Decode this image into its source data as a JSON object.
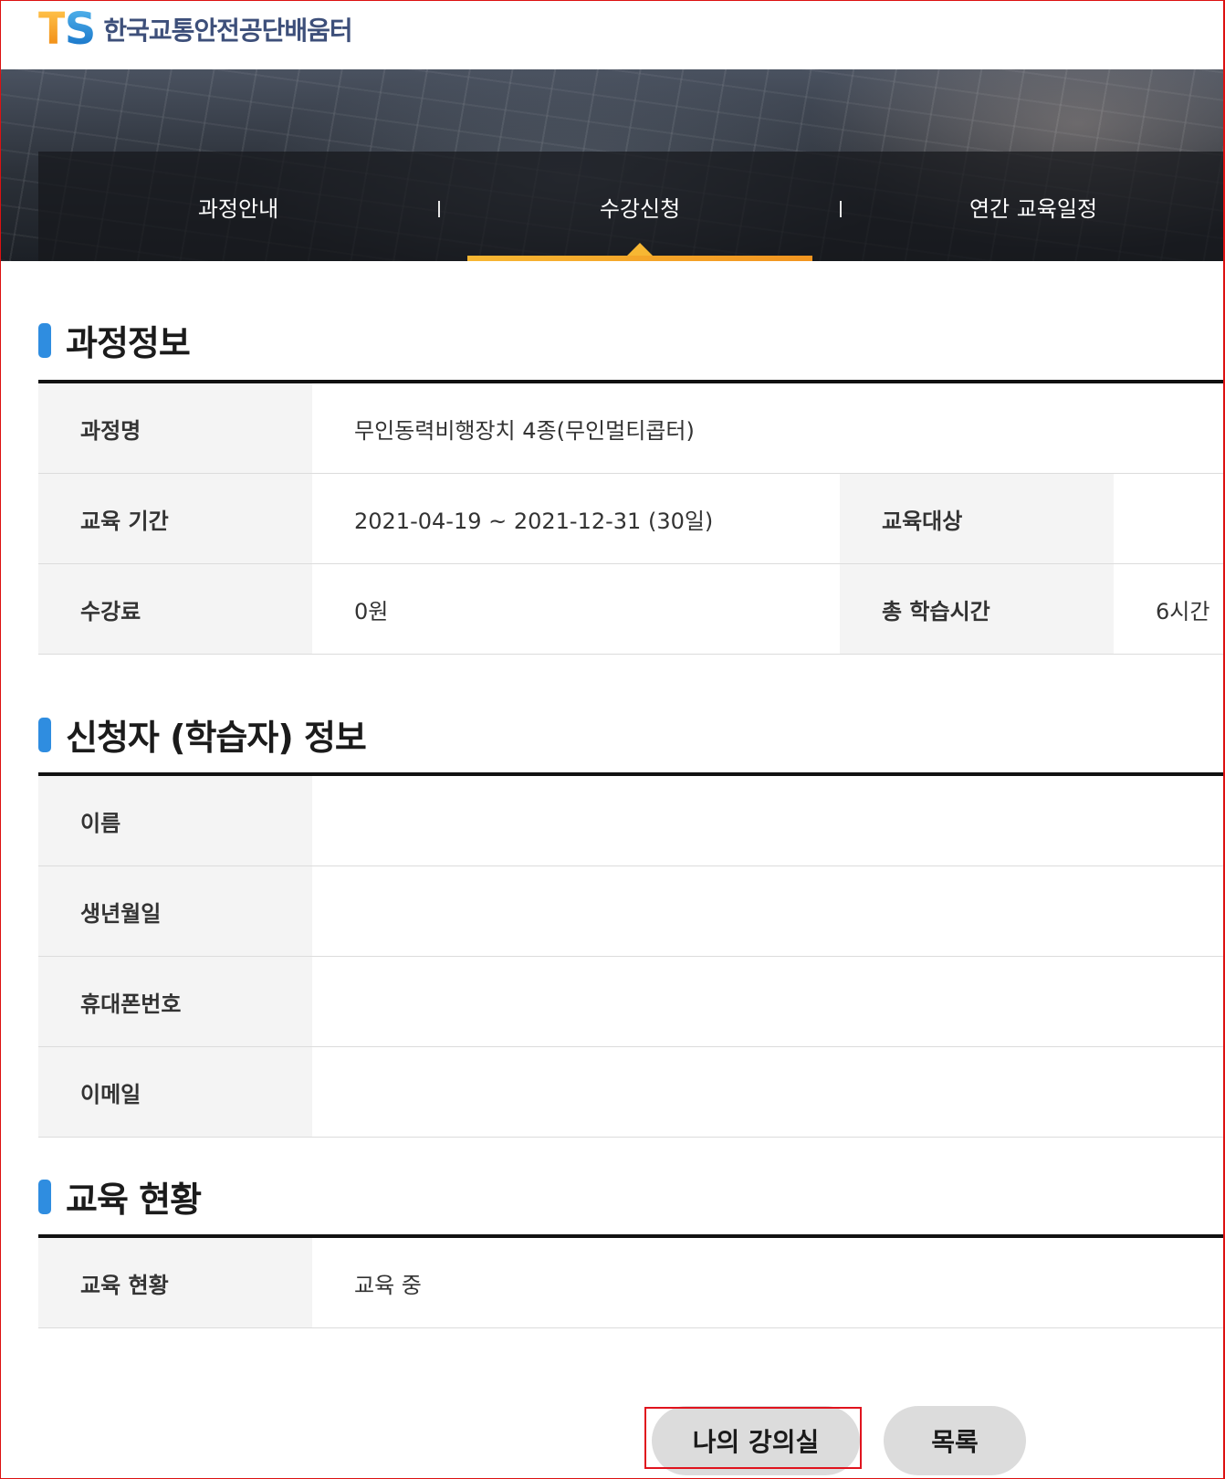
{
  "header": {
    "logo_mark_t": "T",
    "logo_mark_s": "S",
    "logo_text": "한국교통안전공단배움터"
  },
  "nav": {
    "tabs": [
      {
        "label": "과정안내"
      },
      {
        "label": "수강신청",
        "active": true
      },
      {
        "label": "연간 교육일정"
      }
    ],
    "active_color": "#f7b733"
  },
  "course_info": {
    "title": "과정정보",
    "rows": {
      "course_name_label": "과정명",
      "course_name_value": "무인동력비행장치 4종(무인멀티콥터)",
      "period_label": "교육 기간",
      "period_value": "2021-04-19 ~ 2021-12-31 (30일)",
      "target_label": "교육대상",
      "target_value": "",
      "fee_label": "수강료",
      "fee_value": "0원",
      "hours_label": "총 학습시간",
      "hours_value": "6시간"
    }
  },
  "applicant_info": {
    "title": "신청자 (학습자) 정보",
    "rows": {
      "name_label": "이름",
      "name_value": "",
      "birth_label": "생년월일",
      "birth_value": "",
      "phone_label": "휴대폰번호",
      "phone_value": "",
      "email_label": "이메일",
      "email_value": ""
    }
  },
  "education_status": {
    "title": "교육 현황",
    "rows": {
      "status_label": "교육 현황",
      "status_value": "교육 중"
    }
  },
  "buttons": {
    "my_classroom": "나의 강의실",
    "list": "목록"
  },
  "colors": {
    "accent_blue": "#2f8de0",
    "highlight_red": "#e0141e"
  }
}
